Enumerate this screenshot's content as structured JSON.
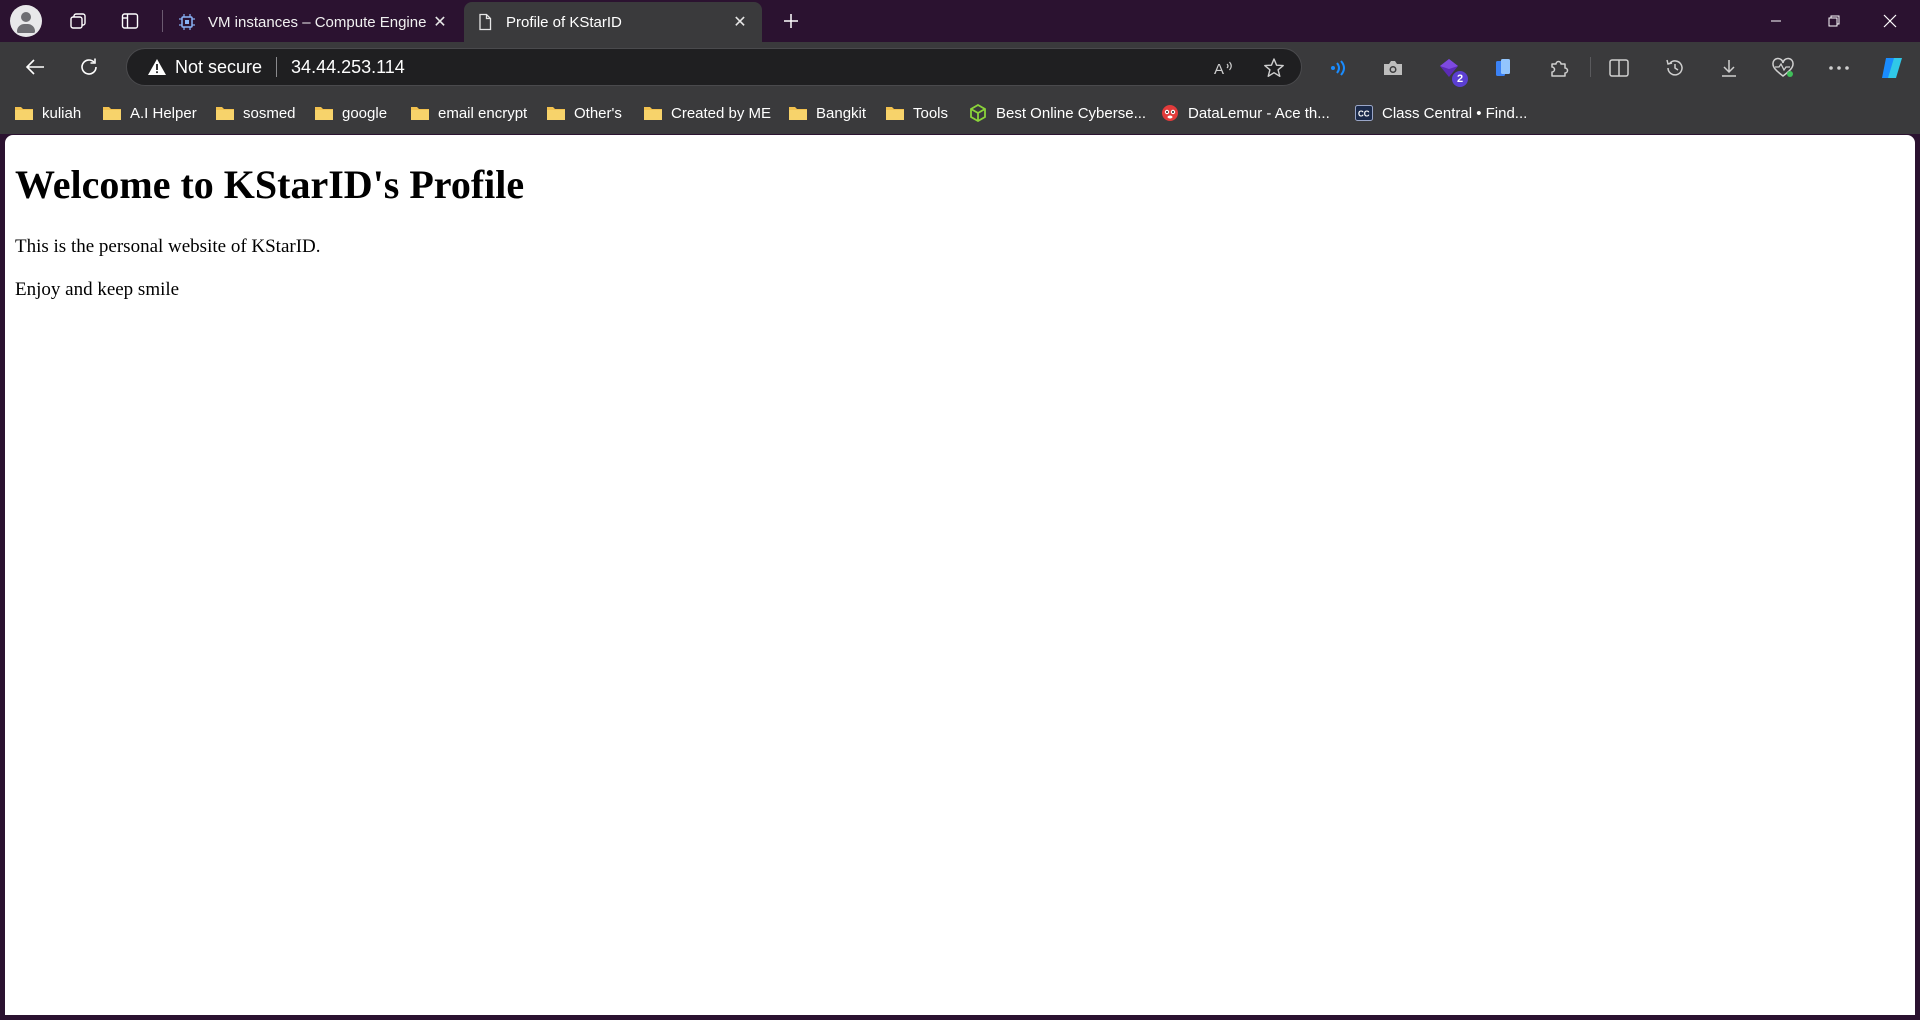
{
  "browser": {
    "tabs": [
      {
        "title": "VM instances – Compute Engine – ",
        "active": false,
        "favicon": "chip-icon"
      },
      {
        "title": "Profile of KStarID",
        "active": true,
        "favicon": "document-icon"
      }
    ],
    "address_bar": {
      "security_label": "Not secure",
      "url": "34.44.253.114"
    },
    "extension_badge": "2",
    "bookmarks": [
      {
        "label": "kuliah",
        "icon": "folder-icon"
      },
      {
        "label": "A.I Helper",
        "icon": "folder-icon"
      },
      {
        "label": "sosmed",
        "icon": "folder-icon"
      },
      {
        "label": "google",
        "icon": "folder-icon"
      },
      {
        "label": "email encrypt",
        "icon": "folder-icon"
      },
      {
        "label": "Other's",
        "icon": "folder-icon"
      },
      {
        "label": "Created by ME",
        "icon": "folder-icon"
      },
      {
        "label": "Bangkit",
        "icon": "folder-icon"
      },
      {
        "label": "Tools",
        "icon": "folder-icon"
      },
      {
        "label": "Best Online Cyberse...",
        "icon": "cube-icon"
      },
      {
        "label": "DataLemur - Ace th...",
        "icon": "lemur-icon"
      },
      {
        "label": "Class Central • Find...",
        "icon": "cc-icon"
      }
    ],
    "colors": {
      "titlebar": "#2b1230",
      "toolbar": "#3a3a3c",
      "folder": "#f2c14e",
      "accent": "#1a8cff"
    }
  },
  "page": {
    "heading": "Welcome to KStarID's Profile",
    "paragraphs": [
      "This is the personal website of KStarID.",
      "Enjoy and keep smile"
    ]
  }
}
